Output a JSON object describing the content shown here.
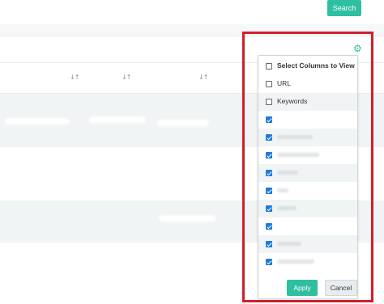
{
  "toolbar": {
    "search_label": "Search"
  },
  "table": {
    "sort_icons": [
      "sort-icon",
      "sort-icon",
      "sort-icon"
    ],
    "sort_glyph": "↓↑"
  },
  "settings": {
    "icon": "gear-icon",
    "color": "#2ebfa0"
  },
  "column_chooser": {
    "header": {
      "label": "Select Columns to View",
      "checked": false
    },
    "options": [
      {
        "label": "URL",
        "checked": false
      },
      {
        "label": "Keywords",
        "checked": false
      },
      {
        "label": "",
        "checked": true
      },
      {
        "label": "",
        "checked": true
      },
      {
        "label": "",
        "checked": true
      },
      {
        "label": "",
        "checked": true
      },
      {
        "label": "",
        "checked": true
      },
      {
        "label": "",
        "checked": true
      },
      {
        "label": "",
        "checked": true
      },
      {
        "label": "",
        "checked": true
      }
    ],
    "apply_label": "Apply",
    "cancel_label": "Cancel"
  },
  "colors": {
    "accent": "#2ebfa0",
    "highlight": "#d0202a",
    "checkbox": "#1f7ae0"
  }
}
